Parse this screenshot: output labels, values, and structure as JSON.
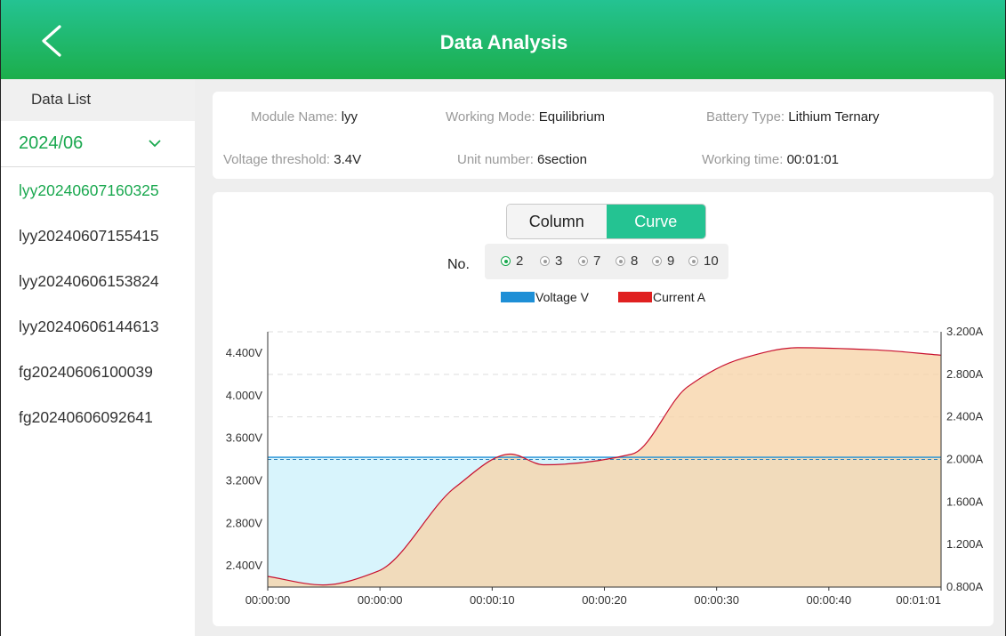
{
  "header": {
    "title": "Data Analysis"
  },
  "sidebar": {
    "heading": "Data List",
    "month": "2024/06",
    "files": [
      "lyy20240607160325",
      "lyy20240607155415",
      "lyy20240606153824",
      "lyy20240606144613",
      "fg20240606100039",
      "fg20240606092641"
    ]
  },
  "info": {
    "module_name_label": "Module Name:",
    "module_name_value": "lyy",
    "working_mode_label": "Working Mode:",
    "working_mode_value": "Equilibrium",
    "battery_type_label": "Battery Type:",
    "battery_type_value": "Lithium Ternary",
    "voltage_threshold_label": "Voltage threshold:",
    "voltage_threshold_value": "3.4V",
    "unit_number_label": "Unit number:",
    "unit_number_value": "6section",
    "working_time_label": "Working time:",
    "working_time_value": "00:01:01"
  },
  "view_toggle": {
    "column_label": "Column",
    "curve_label": "Curve",
    "selected": "Curve"
  },
  "number_select": {
    "label": "No.",
    "options": [
      "2",
      "3",
      "7",
      "8",
      "9",
      "10"
    ],
    "selected": "2"
  },
  "colors": {
    "accent": "#24c392",
    "voltage": "#1e8fd6",
    "current": "#e02020",
    "voltage_fill": "#d8f4fc",
    "current_fill": "#f7d3a8"
  },
  "chart_data": {
    "type": "area",
    "legend": [
      "Voltage V",
      "Current A"
    ],
    "legend_position": "top-center",
    "x_tick_labels": [
      "00:00:00",
      "00:00:00",
      "00:00:10",
      "00:00:20",
      "00:00:30",
      "00:00:40",
      "00:01:01"
    ],
    "y_left_tick_labels": [
      "2.400V",
      "2.800V",
      "3.200V",
      "3.600V",
      "4.000V",
      "4.400V"
    ],
    "y_right_tick_labels": [
      "0.800A",
      "1.200A",
      "1.600A",
      "2.000A",
      "2.400A",
      "2.800A",
      "3.200A"
    ],
    "y_left_range": [
      2.2,
      4.6
    ],
    "y_right_range": [
      0.8,
      3.2
    ],
    "grid": true,
    "threshold": {
      "value": 3.4,
      "unit": "V",
      "style": "dashed"
    },
    "series": [
      {
        "name": "Voltage V",
        "axis": "left",
        "x_seconds": [
          0,
          61
        ],
        "values": [
          3.42,
          3.42
        ]
      },
      {
        "name": "Current A",
        "axis": "right",
        "x_seconds": [
          0,
          5,
          10,
          17,
          22,
          25,
          33,
          38,
          43,
          48,
          55,
          61
        ],
        "values": [
          0.9,
          0.82,
          0.95,
          1.74,
          2.05,
          1.95,
          2.05,
          2.68,
          2.95,
          3.05,
          3.03,
          2.98
        ]
      }
    ]
  }
}
